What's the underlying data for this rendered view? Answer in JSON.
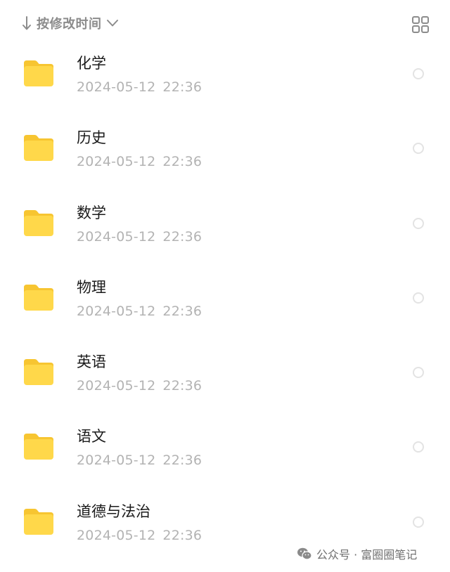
{
  "toolbar": {
    "sort_icon": "arrow-down-icon",
    "sort_label": "按修改时间",
    "sort_chevron_icon": "chevron-down-icon",
    "view_toggle_icon": "grid-view-icon"
  },
  "folders": [
    {
      "name": "化学",
      "date": "2024-05-12",
      "time": "22:36",
      "icon": "folder-icon"
    },
    {
      "name": "历史",
      "date": "2024-05-12",
      "time": "22:36",
      "icon": "folder-icon"
    },
    {
      "name": "数学",
      "date": "2024-05-12",
      "time": "22:36",
      "icon": "folder-icon"
    },
    {
      "name": "物理",
      "date": "2024-05-12",
      "time": "22:36",
      "icon": "folder-icon"
    },
    {
      "name": "英语",
      "date": "2024-05-12",
      "time": "22:36",
      "icon": "folder-icon"
    },
    {
      "name": "语文",
      "date": "2024-05-12",
      "time": "22:36",
      "icon": "folder-icon"
    },
    {
      "name": "道德与法治",
      "date": "2024-05-12",
      "time": "22:36",
      "icon": "folder-icon"
    }
  ],
  "watermark": {
    "text": "公众号 · 富圈圈笔记",
    "icon": "wechat-icon"
  },
  "colors": {
    "folder": "#FFD84A",
    "folder_tab": "#F7C531",
    "primary_text": "#1a1a1a",
    "secondary_text": "#b3b3b3",
    "toolbar_text": "#8c8c8c"
  }
}
